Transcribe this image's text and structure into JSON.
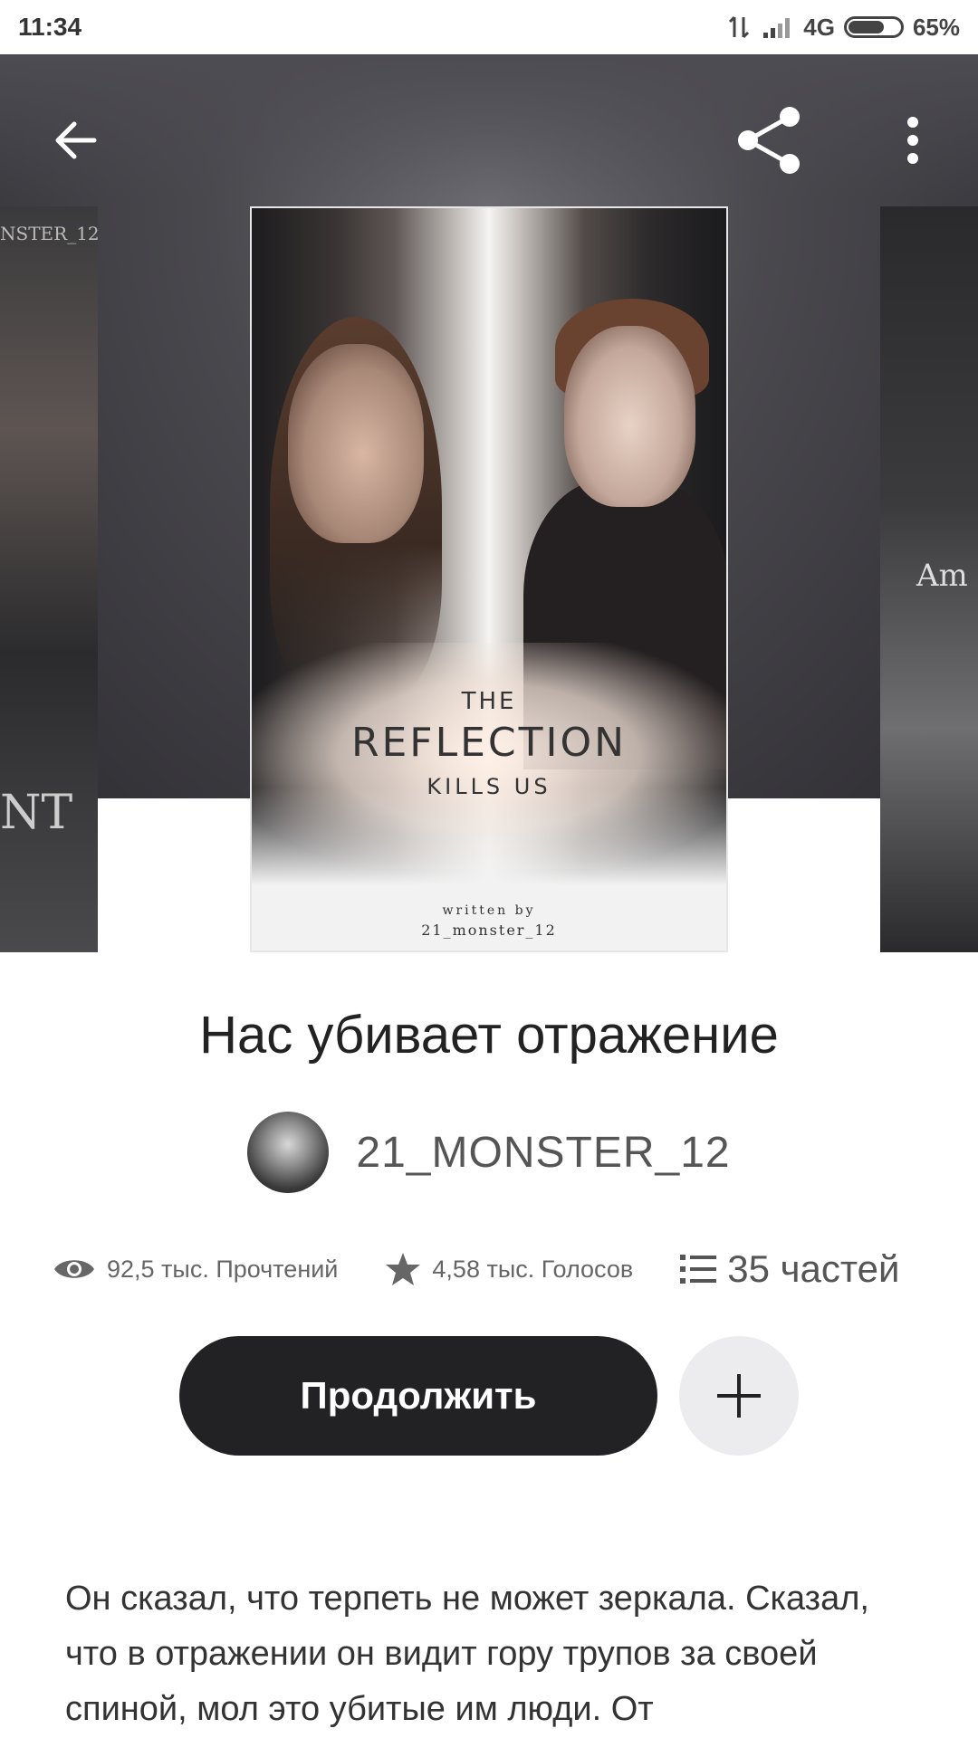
{
  "status_bar": {
    "time": "11:34",
    "network": "4G",
    "battery": "65%",
    "battery_level": 0.65
  },
  "app_bar": {
    "back_icon": "arrow-left-icon",
    "share_icon": "share-icon",
    "more_icon": "more-vert-icon"
  },
  "cover": {
    "line1": "THE",
    "line2": "REFLECTION",
    "line3": "KILLS US",
    "line4": "written by",
    "line5": "21_monster_12"
  },
  "side_covers": {
    "left_text_top": "NSTER_12",
    "left_text_bottom": "NT",
    "right_text": "Am"
  },
  "book": {
    "title": "Нас убивает отражение",
    "author": "21_MONSTER_12"
  },
  "stats": {
    "reads": "92,5 тыс. Прочтений",
    "votes": "4,58 тыс. Голосов",
    "parts": "35 частей"
  },
  "actions": {
    "continue_label": "Продолжить"
  },
  "description": "Он сказал, что терпеть не может зеркала. Сказал, что в отражении он видит гору трупов за своей спиной, мол это убитые им люди. От",
  "colors": {
    "primary_button": "#222123",
    "add_button": "#ecebed",
    "hero_bg": "#4a494e"
  }
}
